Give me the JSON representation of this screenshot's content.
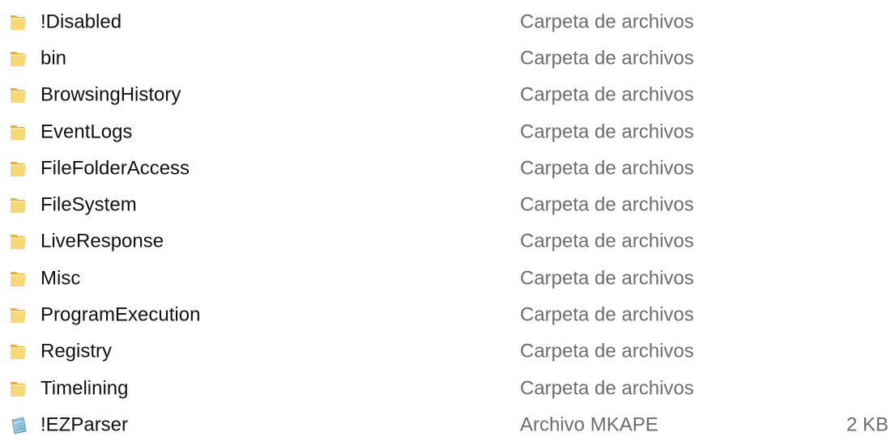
{
  "file_list": {
    "items": [
      {
        "name": "!Disabled",
        "type": "Carpeta de archivos",
        "size": "",
        "icon": "folder-icon"
      },
      {
        "name": "bin",
        "type": "Carpeta de archivos",
        "size": "",
        "icon": "folder-icon"
      },
      {
        "name": "BrowsingHistory",
        "type": "Carpeta de archivos",
        "size": "",
        "icon": "folder-icon"
      },
      {
        "name": "EventLogs",
        "type": "Carpeta de archivos",
        "size": "",
        "icon": "folder-icon"
      },
      {
        "name": "FileFolderAccess",
        "type": "Carpeta de archivos",
        "size": "",
        "icon": "folder-icon"
      },
      {
        "name": "FileSystem",
        "type": "Carpeta de archivos",
        "size": "",
        "icon": "folder-icon"
      },
      {
        "name": "LiveResponse",
        "type": "Carpeta de archivos",
        "size": "",
        "icon": "folder-icon"
      },
      {
        "name": "Misc",
        "type": "Carpeta de archivos",
        "size": "",
        "icon": "folder-icon"
      },
      {
        "name": "ProgramExecution",
        "type": "Carpeta de archivos",
        "size": "",
        "icon": "folder-icon"
      },
      {
        "name": "Registry",
        "type": "Carpeta de archivos",
        "size": "",
        "icon": "folder-icon"
      },
      {
        "name": "Timelining",
        "type": "Carpeta de archivos",
        "size": "",
        "icon": "folder-icon"
      },
      {
        "name": "!EZParser",
        "type": "Archivo MKAPE",
        "size": "2 KB",
        "icon": "notepad-file-icon"
      }
    ]
  },
  "colors": {
    "folder": "#f8d775",
    "folder_dark": "#e2b33e",
    "name_text": "#111111",
    "secondary_text": "#6d6d6d"
  }
}
